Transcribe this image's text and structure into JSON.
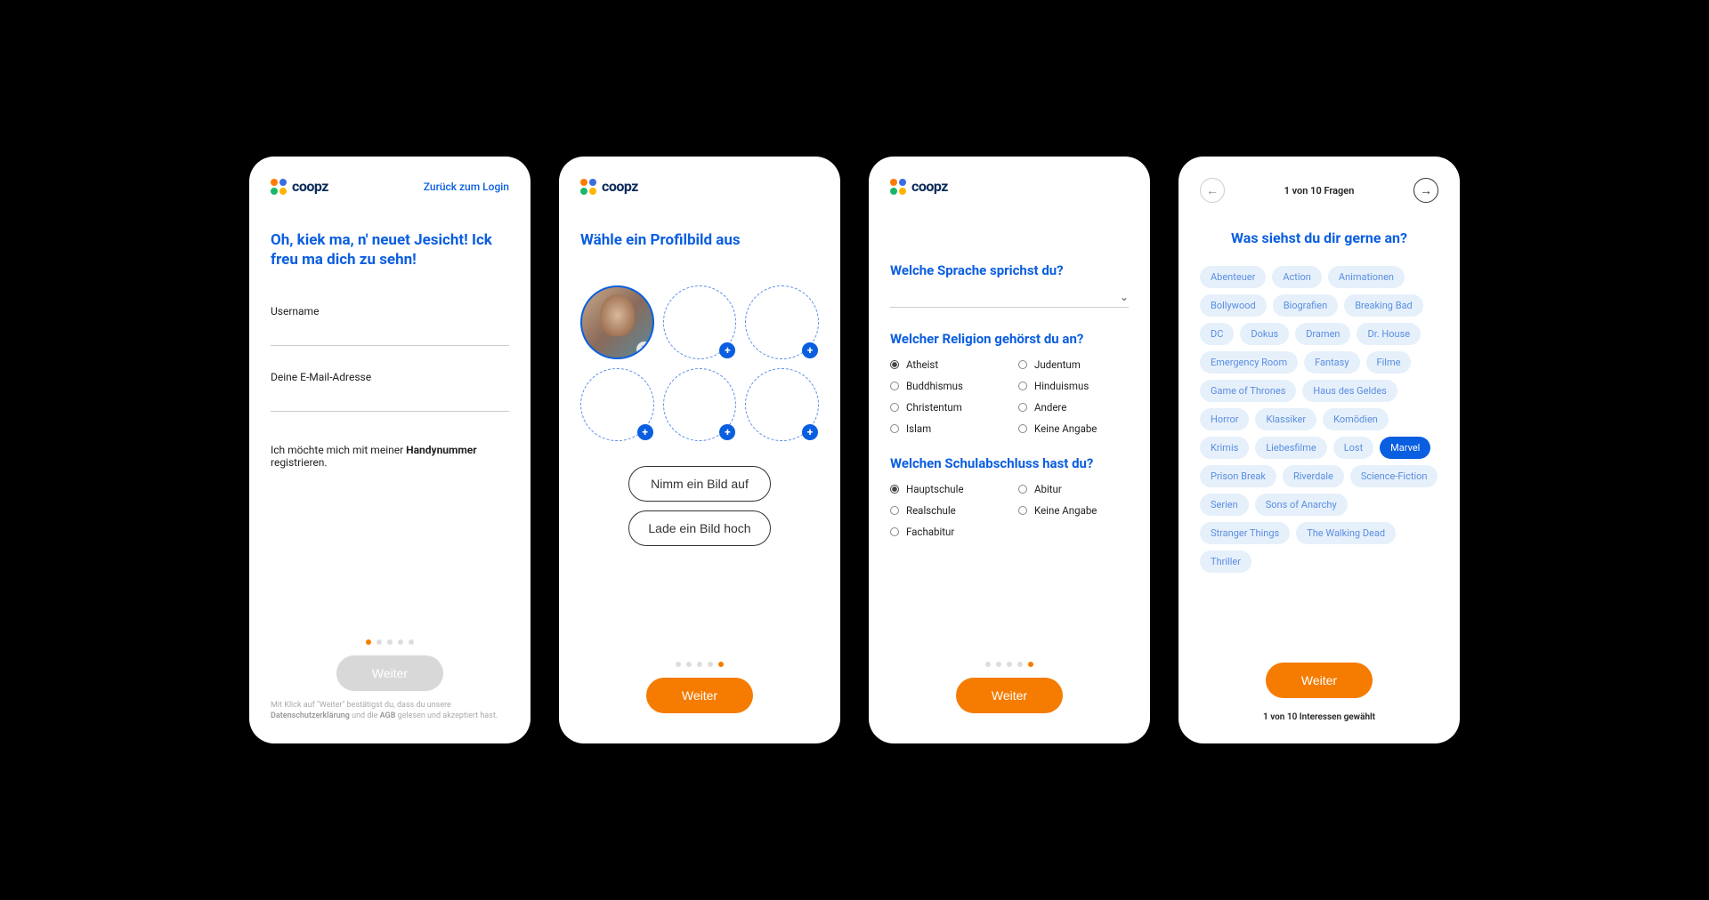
{
  "brand": {
    "name": "coopz",
    "dots": [
      "#ff7b00",
      "#3a6de0",
      "#18b86a",
      "#ffb400"
    ]
  },
  "screen1": {
    "back_link": "Zurück zum Login",
    "heading": "Oh, kiek ma, n' neuet Jesicht! Ick freu ma dich zu sehn!",
    "username_label": "Username",
    "email_label": "Deine E-Mail-Adresse",
    "reg_text_pre": "Ich möchte mich mit meiner ",
    "reg_text_bold": "Handynummer",
    "reg_text_post": " registrieren.",
    "submit": "Weiter",
    "legal_pre": "Mit Klick auf \"Weiter\" bestätigst du, dass du unsere ",
    "legal_b1": "Datenschutzerklärung",
    "legal_mid": " und die ",
    "legal_b2": "AGB",
    "legal_end": " gelesen und akzeptiert hast.",
    "page_dots": 5,
    "active_dot": 0
  },
  "screen2": {
    "heading": "Wähle ein Profilbild aus",
    "take_photo": "Nimm ein Bild auf",
    "upload_photo": "Lade ein Bild hoch",
    "submit": "Weiter",
    "page_dots": 5,
    "active_dot": 4
  },
  "screen3": {
    "q1": "Welche Sprache sprichst du?",
    "q2": "Welcher Religion gehörst du an?",
    "religion_left": [
      "Atheist",
      "Buddhismus",
      "Christentum",
      "Islam"
    ],
    "religion_right": [
      "Judentum",
      "Hinduismus",
      "Andere",
      "Keine Angabe"
    ],
    "religion_selected": "Atheist",
    "q3": "Welchen Schulabschluss hast du?",
    "school_left": [
      "Hauptschule",
      "Realschule",
      "Fachabitur"
    ],
    "school_right": [
      "Abitur",
      "Keine Angabe"
    ],
    "school_selected": "Hauptschule",
    "submit": "Weiter",
    "page_dots": 5,
    "active_dot": 4
  },
  "screen4": {
    "progress": "1 von 10 Fragen",
    "title": "Was siehst du dir gerne an?",
    "tags": [
      "Abenteuer",
      "Action",
      "Animationen",
      "Bollywood",
      "Biografien",
      "Breaking Bad",
      "DC",
      "Dokus",
      "Dramen",
      "Dr. House",
      "Emergency Room",
      "Fantasy",
      "Filme",
      "Game of Thrones",
      "Haus des Geldes",
      "Horror",
      "Klassiker",
      "Komödien",
      "Krimis",
      "Liebesfilme",
      "Lost",
      "Marvel",
      "Prison Break",
      "Riverdale",
      "Science-Fiction",
      "Serien",
      "Sons of Anarchy",
      "Stranger Things",
      "The Walking Dead",
      "Thriller"
    ],
    "selected_tag": "Marvel",
    "submit": "Weiter",
    "count_label": "1 von 10 Interessen gewählt"
  }
}
